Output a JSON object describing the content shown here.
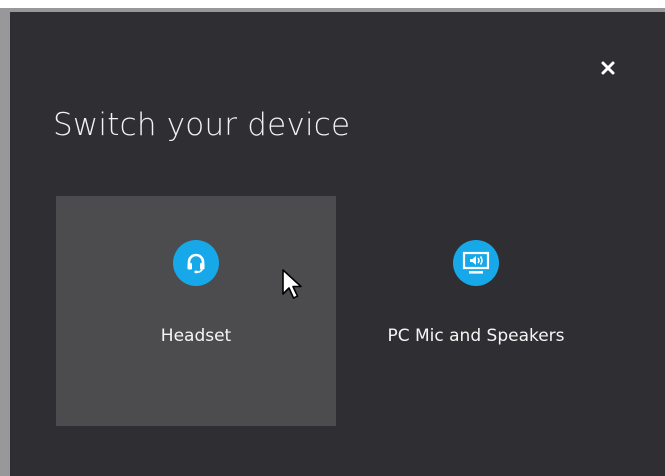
{
  "dialog": {
    "title": "Switch your device",
    "close_icon": "close-icon",
    "devices": [
      {
        "label": "Headset",
        "icon": "headset-icon",
        "selected": true
      },
      {
        "label": "PC Mic and Speakers",
        "icon": "monitor-speaker-icon",
        "selected": false
      }
    ]
  },
  "colors": {
    "panel_background": "#2f2f33",
    "selected_tile_background": "#4c4c4f",
    "icon_circle": "#16a8e9",
    "text": "#f2f2f2"
  }
}
